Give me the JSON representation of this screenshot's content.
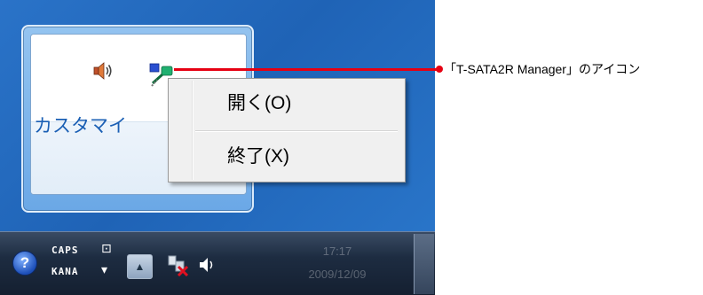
{
  "flyout": {
    "customize_label": "カスタマイ"
  },
  "context_menu": {
    "items": [
      {
        "label": "開く(O)"
      },
      {
        "label": "終了(X)"
      }
    ]
  },
  "taskbar": {
    "help_label": "?",
    "ime": {
      "caps": "CAPS",
      "kana": "KANA",
      "options_glyph": "⊡",
      "dropdown_glyph": "▾"
    },
    "show_hidden_glyph": "▲",
    "clock": {
      "time": "17:17",
      "date": "2009/12/09"
    }
  },
  "callout": {
    "label": "「T-SATA2R Manager」のアイコン"
  },
  "colors": {
    "accent_red": "#e60012",
    "link_blue": "#1a5fb4",
    "desktop_blue": "#1f63b6"
  },
  "icons": [
    "speaker-icon",
    "tsata2r-manager-icon",
    "help-icon",
    "network-disconnected-icon",
    "volume-icon",
    "show-hidden-icons-button"
  ]
}
